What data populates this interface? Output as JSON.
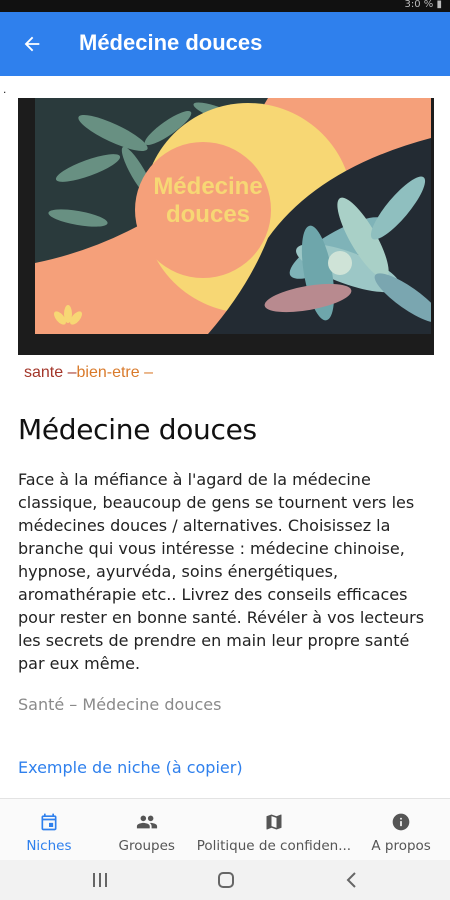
{
  "status_bar": {
    "text": "3:0 % ▮"
  },
  "app_bar": {
    "title": "Médecine douces"
  },
  "stray": ".",
  "hero": {
    "overlay_text_line1": "Médecine",
    "overlay_text_line2": "douces"
  },
  "tags": {
    "first": "sante –",
    "second": "bien-etre –"
  },
  "article": {
    "title": "Médecine douces",
    "description": "Face à la méfiance à l'agard de la médecine classique, beaucoup de gens se tournent vers les médecines douces / alternatives. Choisissez la branche qui vous intéresse : médecine chinoise, hypnose, ayurvéda, soins énergétiques, aromathérapie etc.. Livrez des conseils efficaces pour rester en bonne santé. Révéler à vos lecteurs les secrets de prendre en main leur propre santé par eux même.",
    "category": "Santé – Médecine douces",
    "link_text": "Exemple de niche (à copier)"
  },
  "bottom_nav": {
    "items": [
      {
        "label": "Niches",
        "icon": "calendar-icon",
        "active": true
      },
      {
        "label": "Groupes",
        "icon": "people-icon",
        "active": false
      },
      {
        "label": "Politique de confiden...",
        "icon": "map-icon",
        "active": false
      },
      {
        "label": "A propos",
        "icon": "info-icon",
        "active": false
      }
    ]
  },
  "colors": {
    "primary": "#2f80ed",
    "tag_red": "#a3362a",
    "tag_orange": "#d97a2b",
    "hero_peach": "#f5a07a",
    "hero_yellow": "#f7d774",
    "hero_dark": "#232b33"
  }
}
